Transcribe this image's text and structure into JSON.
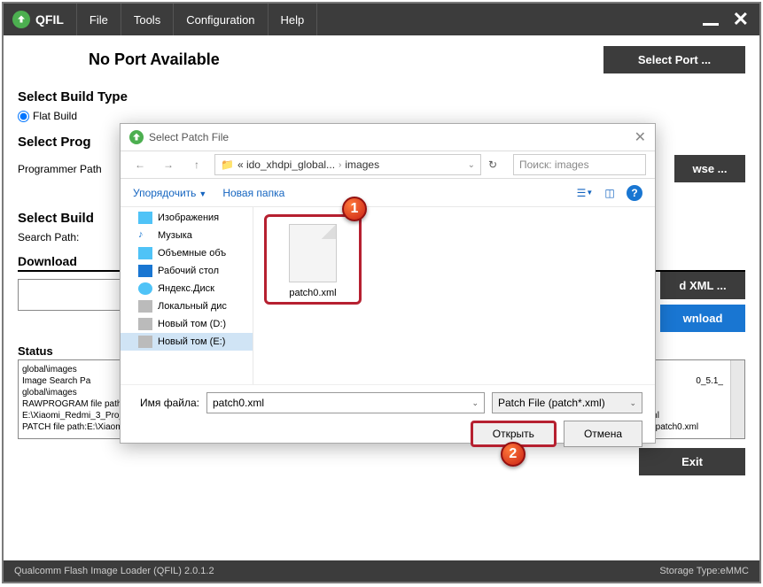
{
  "app": {
    "title": "QFIL"
  },
  "menu": [
    "File",
    "Tools",
    "Configuration",
    "Help"
  ],
  "port": {
    "status": "No Port Available",
    "select_btn": "Select Port ..."
  },
  "build": {
    "label": "Select Build Type",
    "radio": "Flat Build"
  },
  "prog": {
    "label": "Select Prog",
    "path_label": "Programmer Path",
    "browse": "wse ..."
  },
  "build2": {
    "label": "Select Build",
    "search": "Search Path:"
  },
  "download": {
    "header": "Download",
    "xml_btn": "d XML ...",
    "dl_btn": "wnload"
  },
  "status": {
    "label": "Status",
    "lines": [
      "global\\images",
      "Image Search Pa",
      "global\\images",
      "RAWPROGRAM file path: E:\\Xiaomi_Redmi_3_Pro_IDO\\off_firmwares\\fastboot\\stable\\ido_xhdpi_global_images_V9.6.1.0.LAIMIFD_20180711.0000.00_5.1_global\\images\\rawprogram0.xml",
      "PATCH file path:E:\\Xiaomi_Redmi_3_Pro_IDO\\off_firmwares\\fastboot\\stable\\ido_xhdpi_global_images_V9.6.1.0.LAIMIFD_20180711.0000.00_5.1_global\\images\\patch0.xml"
    ],
    "frag": "0_5.1_"
  },
  "exit": "Exit",
  "footer": {
    "left": "Qualcomm Flash Image Loader (QFIL)   2.0.1.2",
    "right": "Storage Type:eMMC"
  },
  "dialog": {
    "title": "Select Patch File",
    "path": [
      "« ido_xhdpi_global...",
      "images"
    ],
    "search_ph": "Поиск: images",
    "organize": "Упорядочить",
    "new_folder": "Новая папка",
    "sidebar": [
      {
        "label": "Изображения",
        "color": "#2196f3"
      },
      {
        "label": "Музыка",
        "color": "#2196f3"
      },
      {
        "label": "Объемные объ",
        "color": "#2196f3"
      },
      {
        "label": "Рабочий стол",
        "color": "#2196f3"
      },
      {
        "label": "Яндекс.Диск",
        "color": "#2196f3"
      },
      {
        "label": "Локальный дис",
        "color": "#888"
      },
      {
        "label": "Новый том (D:)",
        "color": "#888"
      },
      {
        "label": "Новый том (E:)",
        "color": "#888",
        "sel": true
      }
    ],
    "file": "patch0.xml",
    "fname_label": "Имя файла:",
    "fname_value": "patch0.xml",
    "filter": "Patch File (patch*.xml)",
    "open": "Открыть",
    "cancel": "Отмена"
  },
  "badges": {
    "one": "1",
    "two": "2"
  }
}
